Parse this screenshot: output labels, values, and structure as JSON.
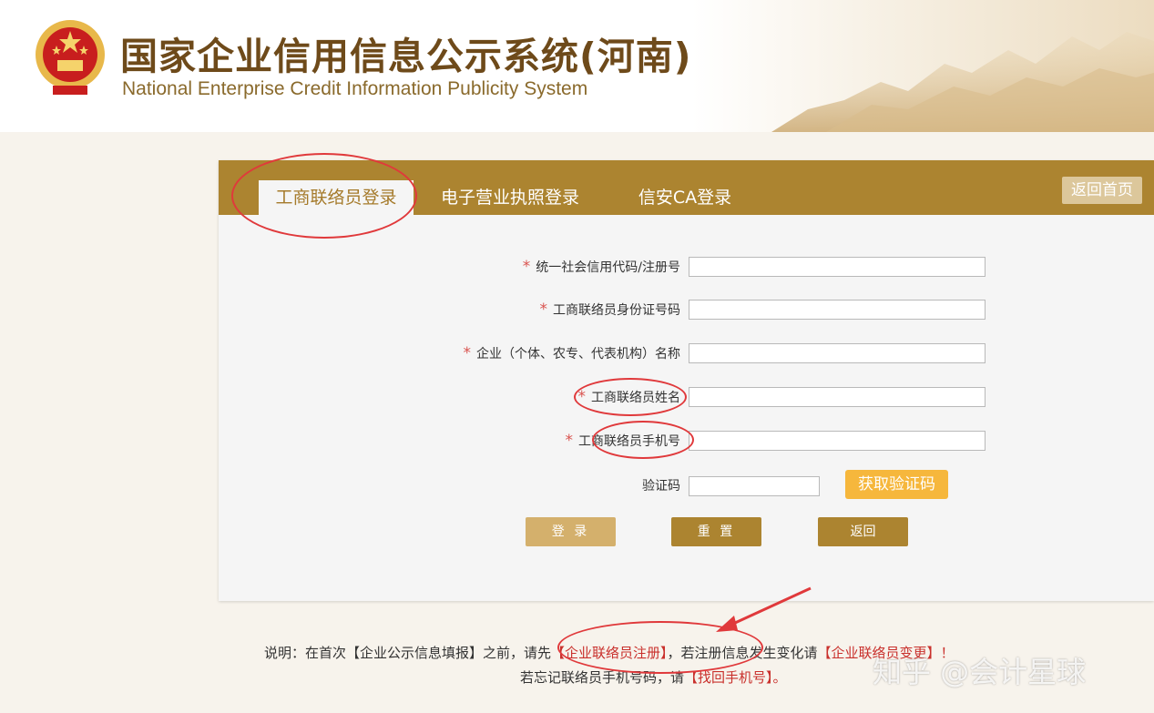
{
  "header": {
    "title": "国家企业信用信息公示系统(河南)",
    "subtitle": "National Enterprise Credit Information Publicity System"
  },
  "tabs": [
    {
      "label": "工商联络员登录",
      "active": true
    },
    {
      "label": "电子营业执照登录",
      "active": false
    },
    {
      "label": "信安CA登录",
      "active": false
    }
  ],
  "home_button": "返回首页",
  "form": {
    "fields": [
      {
        "label": "统一社会信用代码/注册号",
        "required": true,
        "value": ""
      },
      {
        "label": "工商联络员身份证号码",
        "required": true,
        "value": ""
      },
      {
        "label": "企业（个体、农专、代表机构）名称",
        "required": true,
        "value": ""
      },
      {
        "label": "工商联络员姓名",
        "required": true,
        "value": ""
      },
      {
        "label": "工商联络员手机号",
        "required": true,
        "value": ""
      }
    ],
    "captcha": {
      "label": "验证码",
      "value": "",
      "button": "获取验证码"
    },
    "required_mark": "*"
  },
  "actions": {
    "login": "登 录",
    "reset": "重 置",
    "back": "返回"
  },
  "note": {
    "prefix": "说明：在首次【企业公示信息填报】之前，请先",
    "register_link": "【企业联络员注册】",
    "middle": "，若注册信息发生变化请",
    "change_link": "【企业联络员变更】",
    "end1": "！",
    "line2_prefix": "若忘记联络员手机号码，请",
    "retrieve_link": "【找回手机号】",
    "end2": "。"
  },
  "watermark": "知乎 @会计星球",
  "colors": {
    "brand": "#ac8430",
    "accent": "#f6b73c",
    "annotation": "#e0393b"
  }
}
